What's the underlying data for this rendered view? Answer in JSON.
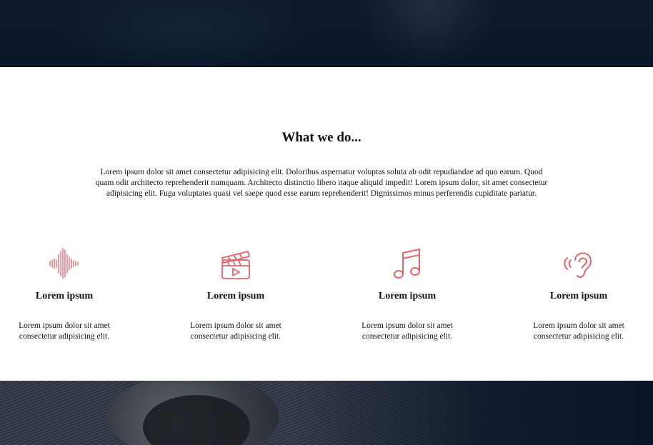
{
  "section": {
    "title": "What we do...",
    "description": "Lorem ipsum dolor sit amet consectetur adipisicing elit. Doloribus aspernatur voluptas soluta ab odit repudiandae ad quo earum. Quod quam odit architecto reprehenderit numquam. Architecto distinctio libero itaque aliquid impedit! Lorem ipsum dolor, sit amet consectetur adipisicing elit. Fuga voluptates quasi vel saepe quod esse earum reprehenderit! Dignissimos minus perferendis cupiditate pariatur."
  },
  "features": [
    {
      "icon": "sound-wave-icon",
      "title": "Lorem ipsum",
      "text": "Lorem ipsum dolor sit amet consectetur adipisicing elit."
    },
    {
      "icon": "clapperboard-icon",
      "title": "Lorem ipsum",
      "text": "Lorem ipsum dolor sit amet consectetur adipisicing elit."
    },
    {
      "icon": "music-note-icon",
      "title": "Lorem ipsum",
      "text": "Lorem ipsum dolor sit amet consectetur adipisicing elit."
    },
    {
      "icon": "ear-sound-icon",
      "title": "Lorem ipsum",
      "text": "Lorem ipsum dolor sit amet consectetur adipisicing elit."
    }
  ],
  "colors": {
    "accent": "#e8626a",
    "hero_background": "#0a1628"
  }
}
